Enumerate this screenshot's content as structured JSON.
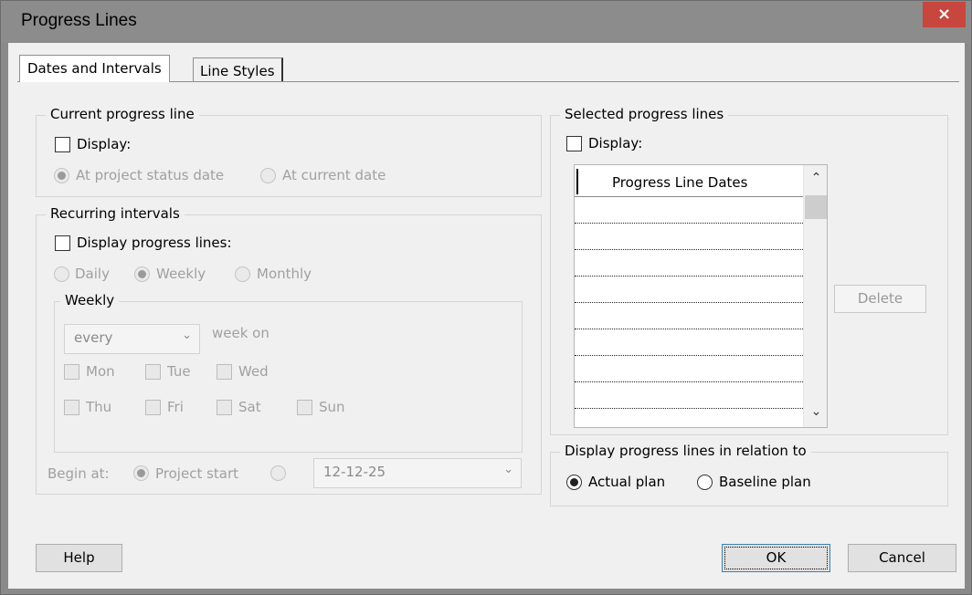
{
  "window": {
    "title": "Progress Lines",
    "close_glyph": "×"
  },
  "tabs": [
    {
      "label": "Dates and Intervals"
    },
    {
      "label": "Line Styles"
    }
  ],
  "current": {
    "group_title": "Current progress line",
    "display_label": "Display:",
    "radio_status_date": "At project status date",
    "radio_current_date": "At current date"
  },
  "recurring": {
    "group_title": "Recurring intervals",
    "display_label": "Display progress lines:",
    "daily": "Daily",
    "weekly": "Weekly",
    "monthly": "Monthly",
    "weekly_group": "Weekly",
    "every_value": "every",
    "week_on": "week on",
    "days": [
      "Mon",
      "Tue",
      "Wed",
      "Thu",
      "Fri",
      "Sat",
      "Sun"
    ],
    "begin_at": "Begin at:",
    "project_start": "Project start",
    "date_value": "12-12-25"
  },
  "selected": {
    "group_title": "Selected progress lines",
    "display_label": "Display:",
    "column_header": "Progress Line Dates",
    "rows": [
      "",
      "",
      "",
      "",
      "",
      "",
      "",
      "",
      ""
    ],
    "delete_label": "Delete"
  },
  "relation": {
    "group_title": "Display progress lines in relation to",
    "actual": "Actual plan",
    "baseline": "Baseline plan"
  },
  "buttons": {
    "help": "Help",
    "ok": "OK",
    "cancel": "Cancel"
  }
}
